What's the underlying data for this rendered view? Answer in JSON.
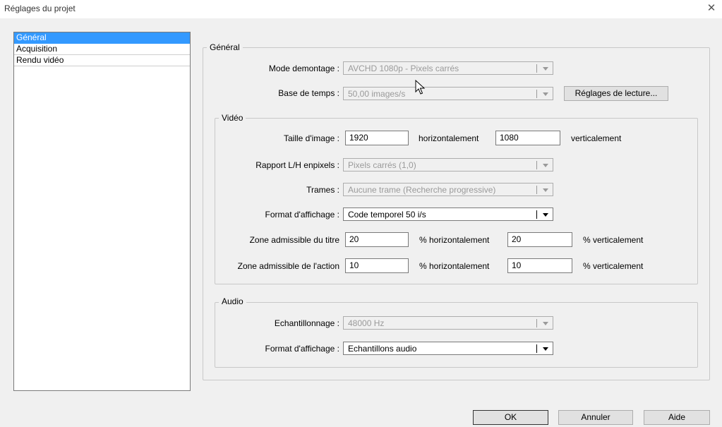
{
  "window": {
    "title": "Réglages du projet",
    "close": "✕"
  },
  "sidebar": {
    "items": [
      {
        "label": "Général"
      },
      {
        "label": "Acquisition"
      },
      {
        "label": "Rendu vidéo"
      }
    ]
  },
  "general": {
    "legend": "Général",
    "mode_label": "Mode demontage :",
    "mode_value": "AVCHD 1080p - Pixels carrés",
    "timebase_label": "Base de temps :",
    "timebase_value": "50,00 images/s",
    "playback_button": "Réglages de lecture..."
  },
  "video": {
    "legend": "Vidéo",
    "frame_size_label": "Taille d'image :",
    "frame_width": "1920",
    "horizontal_label": "horizontalement",
    "frame_height": "1080",
    "vertical_label": "verticalement",
    "pixel_ratio_label": "Rapport L/H enpixels :",
    "pixel_ratio_value": "Pixels carrés (1,0)",
    "fields_label": "Trames :",
    "fields_value": "Aucune trame (Recherche progressive)",
    "display_format_label": "Format d'affichage :",
    "display_format_value": "Code temporel 50 i/s",
    "title_safe_label": "Zone admissible du titre",
    "title_safe_h": "20",
    "title_safe_h_label": "% horizontalement",
    "title_safe_v": "20",
    "title_safe_v_label": "% verticalement",
    "action_safe_label": "Zone admissible de l'action",
    "action_safe_h": "10",
    "action_safe_h_label": "% horizontalement",
    "action_safe_v": "10",
    "action_safe_v_label": "% verticalement"
  },
  "audio": {
    "legend": "Audio",
    "sample_rate_label": "Echantillonnage :",
    "sample_rate_value": "48000 Hz",
    "display_format_label": "Format d'affichage :",
    "display_format_value": "Echantillons audio"
  },
  "footer": {
    "ok": "OK",
    "cancel": "Annuler",
    "help": "Aide"
  }
}
